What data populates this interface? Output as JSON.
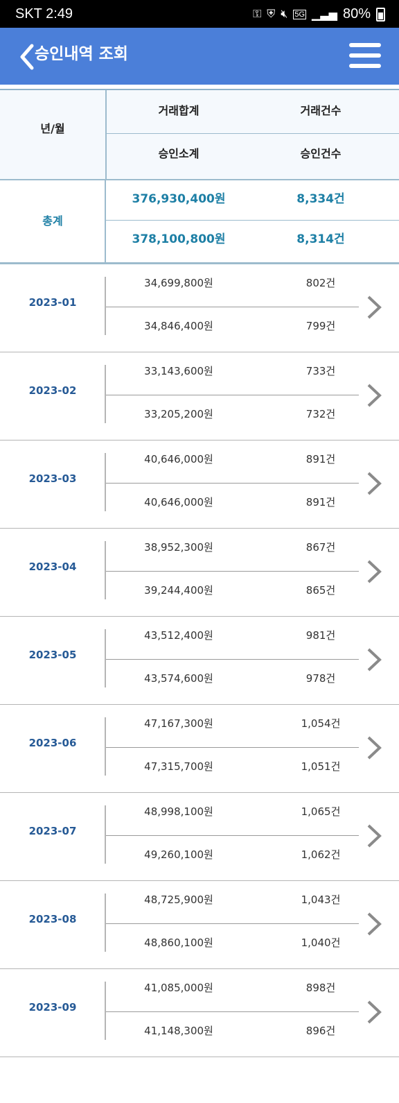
{
  "status_bar": {
    "carrier_time": "SKT 2:49",
    "network": "5G",
    "battery": "80%",
    "icons": [
      "key-icon",
      "shield-icon",
      "mute-icon",
      "signal-icon",
      "battery-icon"
    ]
  },
  "app_bar": {
    "title": "승인내역 조회",
    "back_icon": "chevron-left-icon",
    "menu_icon": "hamburger-icon"
  },
  "table_header": {
    "month_label": "년/월",
    "trans_total": "거래합계",
    "trans_count": "거래건수",
    "approved_subtotal": "승인소계",
    "approved_count": "승인건수"
  },
  "total": {
    "label": "총계",
    "trans_amount": "376,930,400원",
    "trans_count": "8,334건",
    "approved_amount": "378,100,800원",
    "approved_count": "8,314건"
  },
  "rows": [
    {
      "month": "2023-01",
      "trans_amount": "34,699,800원",
      "trans_count": "802건",
      "approved_amount": "34,846,400원",
      "approved_count": "799건"
    },
    {
      "month": "2023-02",
      "trans_amount": "33,143,600원",
      "trans_count": "733건",
      "approved_amount": "33,205,200원",
      "approved_count": "732건"
    },
    {
      "month": "2023-03",
      "trans_amount": "40,646,000원",
      "trans_count": "891건",
      "approved_amount": "40,646,000원",
      "approved_count": "891건"
    },
    {
      "month": "2023-04",
      "trans_amount": "38,952,300원",
      "trans_count": "867건",
      "approved_amount": "39,244,400원",
      "approved_count": "865건"
    },
    {
      "month": "2023-05",
      "trans_amount": "43,512,400원",
      "trans_count": "981건",
      "approved_amount": "43,574,600원",
      "approved_count": "978건"
    },
    {
      "month": "2023-06",
      "trans_amount": "47,167,300원",
      "trans_count": "1,054건",
      "approved_amount": "47,315,700원",
      "approved_count": "1,051건"
    },
    {
      "month": "2023-07",
      "trans_amount": "48,998,100원",
      "trans_count": "1,065건",
      "approved_amount": "49,260,100원",
      "approved_count": "1,062건"
    },
    {
      "month": "2023-08",
      "trans_amount": "48,725,900원",
      "trans_count": "1,043건",
      "approved_amount": "48,860,100원",
      "approved_count": "1,040건"
    },
    {
      "month": "2023-09",
      "trans_amount": "41,085,000원",
      "trans_count": "898건",
      "approved_amount": "41,148,300원",
      "approved_count": "896건"
    }
  ],
  "colors": {
    "app_bar": "#4b7fd9",
    "accent_total": "#1d7fa5",
    "month_text": "#265a96",
    "header_bg": "#f5f9fd"
  }
}
